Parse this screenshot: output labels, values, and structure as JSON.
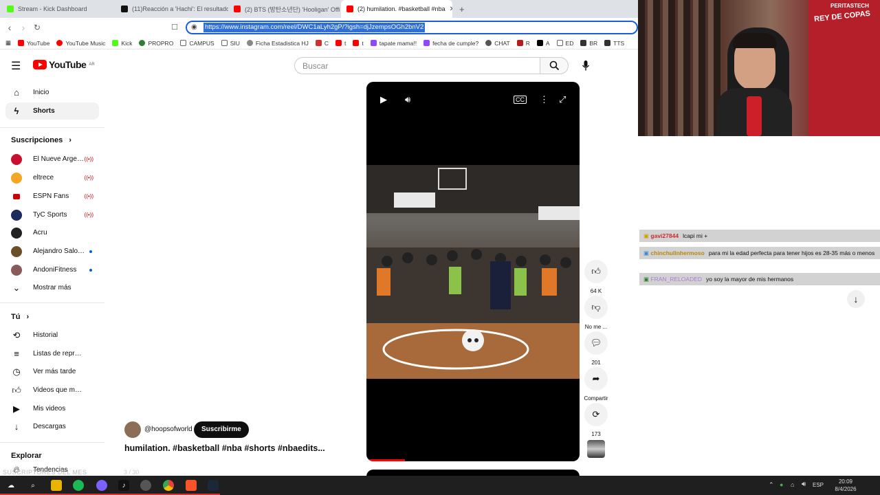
{
  "browser": {
    "tabs": [
      {
        "title": "Stream - Kick Dashboard",
        "favicon_color": "#53fc18"
      },
      {
        "title": "(11)Reacción a 'Hachi': El resultado y",
        "favicon_color": "#111111"
      },
      {
        "title": "(2) BTS (방탄소년단) 'Hooligan' Offici",
        "favicon_color": "#ff0000"
      },
      {
        "title": "(2) humilation. #basketball #nba",
        "favicon_color": "#ff0000"
      }
    ],
    "url": "https://www.instagram.com/reel/DWC1aLyh2gP/?igsh=djJzempsOGh2bnV2",
    "bookmarks": [
      "YouTube",
      "YouTube Music",
      "Kick",
      "PROPRO",
      "CAMPUS",
      "SIU",
      "Ficha Estadistica HJ",
      "C",
      "t",
      "t",
      "tapate mama!!",
      "fecha de cumple?",
      "CHAT",
      "R",
      "A",
      "ED",
      "BR",
      "TTS"
    ]
  },
  "youtube": {
    "logo_text": "YouTube",
    "region": "AR",
    "search_placeholder": "Buscar",
    "sidebar": {
      "main": [
        {
          "label": "Inicio",
          "icon": "home-icon"
        },
        {
          "label": "Shorts",
          "icon": "shorts-icon"
        }
      ],
      "subscriptions_title": "Suscripciones",
      "subscriptions": [
        {
          "label": "El Nueve Argentin...",
          "status": "live",
          "color": "#c8102e"
        },
        {
          "label": "eltrece",
          "status": "live",
          "color": "#f5a623"
        },
        {
          "label": "ESPN Fans",
          "status": "live",
          "color": "#cc0000"
        },
        {
          "label": "TyC Sports",
          "status": "live",
          "color": "#1a2b5c"
        },
        {
          "label": "Acru",
          "status": "",
          "color": "#222222"
        },
        {
          "label": "Alejandro Salom...",
          "status": "new",
          "color": "#6b4f2a"
        },
        {
          "label": "AndoniFitness",
          "status": "new",
          "color": "#8a5a5a"
        },
        {
          "label": "Mostrar más",
          "status": "",
          "color": ""
        }
      ],
      "you_title": "Tú",
      "you": [
        {
          "label": "Historial",
          "icon": "history-icon"
        },
        {
          "label": "Listas de reproducc...",
          "icon": "playlists-icon"
        },
        {
          "label": "Ver más tarde",
          "icon": "watch-later-icon"
        },
        {
          "label": "Videos que me gus...",
          "icon": "liked-icon"
        },
        {
          "label": "Mis videos",
          "icon": "my-videos-icon"
        },
        {
          "label": "Descargas",
          "icon": "downloads-icon"
        }
      ],
      "explore_title": "Explorar",
      "explore_first": "Tendencias"
    },
    "short": {
      "channel": "@hoopsofworld",
      "subscribe_label": "Suscribirme",
      "title": "humilation. #basketball #nba #shorts #nbaedits...",
      "likes": "64 K",
      "dislike_label": "No me ...",
      "comments": "201",
      "share_label": "Compartir",
      "remix": "173",
      "progress": 0.18
    }
  },
  "stream_overlay": {
    "webcam_banner": "PERITASTECH",
    "wall_text": "REY DE COPAS",
    "overlay_text": "SUSCRIPTORES DEL MES",
    "overlay_count": "3 / 30"
  },
  "chat": [
    {
      "user": "gavi27844",
      "user_color": "#cc2b2b",
      "text": "lcapi mi +"
    },
    {
      "user": "chinchullnhermoso",
      "user_color": "#d4a017",
      "text": "para mi la edad perfecta para tener hijos es 28-35 más o menos"
    },
    {
      "user": "FRAN_RELOADED",
      "user_color": "#a97fd6",
      "text": "yo soy la mayor de mis hermanos"
    }
  ],
  "taskbar": {
    "time": "20:09",
    "date": "8/4/2026",
    "lang": "ESP"
  }
}
